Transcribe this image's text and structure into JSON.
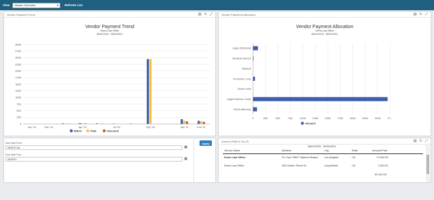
{
  "toolbar": {
    "view_label": "View",
    "view_value": "Vendor Overview",
    "refresh_label": "Refresh List"
  },
  "trend_panel": {
    "header": "Vendor Payment Trend",
    "title": "Vendor Payment Trend",
    "subtitle": "Demo Law Office",
    "date_range": "06/01/2016 - 05/31/2021",
    "icons": [
      "table-icon",
      "refresh-icon",
      "expand-icon"
    ]
  },
  "allocation_panel": {
    "header": "Vendor Payments Allocation",
    "title": "Vendor Payment Allocation",
    "subtitle": "Demo Law Office",
    "date_range": "06/01/2016 - 05/31/2021"
  },
  "filters": {
    "from_label": "Due Date From",
    "from_value": "MONTH-36",
    "thru_label": "Due Date Thru",
    "thru_value": "MONTH",
    "apply_label": "Apply"
  },
  "taxid_panel": {
    "header": "Amount Paid to Tax ID",
    "date_range": "06/01/2020 - 05/31/2021",
    "columns": [
      "Vendor Name",
      "Address",
      "City",
      "State",
      "Amount Paid"
    ],
    "rows": [
      [
        "Demo Law Office",
        "P.o. Box 75697 Sanford Station",
        "Los Angeles",
        "CA",
        "17,000.25"
      ],
      [
        "Demo Law Office",
        "330 Golden Shore Dr",
        "Long Beach",
        "CA",
        "7,400.00"
      ]
    ],
    "total": "$7,400.00"
  },
  "chart_data": [
    {
      "type": "bar",
      "title": "Vendor Payment Trend",
      "subtitle": "Demo Law Office",
      "categories": [
        "Jan '19",
        "Feb '19",
        "",
        "Apr '20",
        "",
        "Jul '20",
        "",
        "Sep '20",
        "",
        "Jan '21",
        "Feb '21"
      ],
      "series": [
        {
          "name": "Billed",
          "color": "#3e5eab",
          "values": [
            0,
            0,
            2,
            3,
            2,
            1,
            1,
            245,
            0,
            18,
            12
          ]
        },
        {
          "name": "Paid",
          "color": "#f2c244",
          "values": [
            0,
            0,
            1,
            2,
            1,
            1,
            1,
            245,
            0,
            12,
            10
          ]
        },
        {
          "name": "Discount",
          "color": "#e2532a",
          "values": [
            0,
            0,
            1,
            2,
            1,
            0,
            0,
            0,
            0,
            10,
            8
          ]
        }
      ],
      "y_ticks": [
        "0",
        "25K",
        "50K",
        "75K",
        "100K",
        "125K",
        "150K",
        "175K",
        "200K",
        "225K",
        "250K",
        "275K",
        "300K"
      ],
      "ylim": [
        0,
        300
      ],
      "legend": "bottom"
    },
    {
      "type": "bar",
      "orientation": "horizontal",
      "title": "Vendor Payment Allocation",
      "subtitle": "Demo Law Office",
      "categories": [
        "Legal (Defense)",
        "Medical Interest",
        "Medical",
        "Economic Loss",
        "Doctor Visit",
        "Legal Defense Costs",
        "Clinch Attorney"
      ],
      "series": [
        {
          "name": "Amount",
          "color": "#3e5eab",
          "values": [
            10,
            1,
            0,
            4,
            0,
            270,
            8
          ]
        }
      ],
      "x_ticks": [
        "0",
        "25K",
        "50K",
        "75K",
        "100K",
        "125K",
        "150K",
        "175K",
        "200K",
        "225K",
        "250K",
        "27..."
      ],
      "xlim": [
        0,
        275
      ],
      "legend": "bottom"
    }
  ]
}
